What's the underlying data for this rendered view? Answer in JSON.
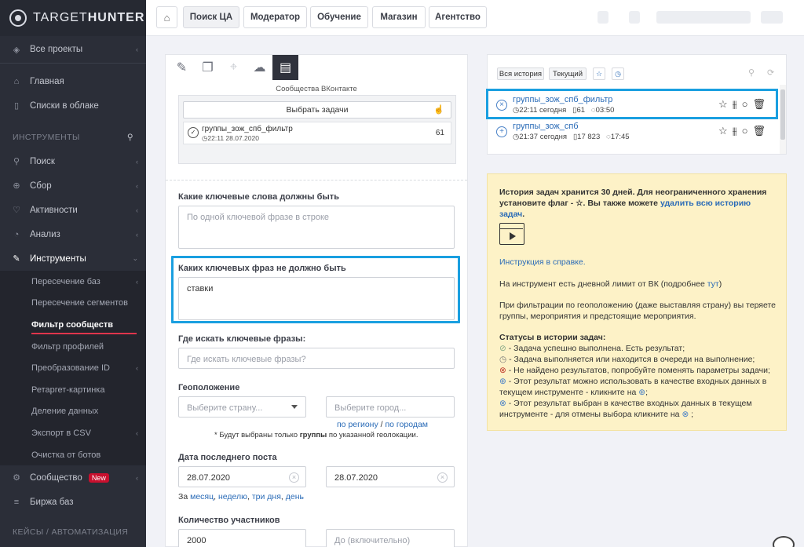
{
  "brand": {
    "name_light": "TARGET",
    "name_bold": "HUNTER"
  },
  "sidebar": {
    "all_projects": "Все проекты",
    "main": "Главная",
    "cloud_lists": "Списки в облаке",
    "section_tools": "ИНСТРУМЕНТЫ",
    "search": "Поиск",
    "collect": "Сбор",
    "activity": "Активности",
    "analysis": "Анализ",
    "tools": "Инструменты",
    "sub": [
      "Пересечение баз",
      "Пересечение сегментов",
      "Фильтр сообществ",
      "Фильтр профилей",
      "Преобразование ID",
      "Ретаргет-картинка",
      "Деление данных",
      "Экспорт в CSV",
      "Очистка от ботов"
    ],
    "community": "Сообщество",
    "new_badge": "New",
    "exchange": "Биржа баз",
    "section_cases": "КЕЙСЫ / АВТОМАТИЗАЦИЯ"
  },
  "topnav": [
    "Поиск ЦА",
    "Модератор",
    "Обучение",
    "Магазин",
    "Агентство"
  ],
  "filter": {
    "vk_title": "Сообщества ВКонтакте",
    "pick_tasks": "Выбрать задачи",
    "task_name": "группы_зож_спб_фильтр",
    "task_meta": "22:11 28.07.2020",
    "task_count": "61",
    "kw_must_label": "Какие ключевые слова должны быть",
    "kw_must_placeholder": "По одной ключевой фразе в строке",
    "kw_not_label": "Каких ключевых фраз не должно быть",
    "kw_not_value": "ставки",
    "where_label": "Где искать ключевые фразы:",
    "where_placeholder": "Где искать ключевые фразы?",
    "geo_label": "Геоположение",
    "country_placeholder": "Выберите страну...",
    "city_placeholder": "Выберите город...",
    "by_region": "по региону",
    "slash": "/",
    "by_cities": "по городам",
    "geo_note_pre": "* Будут выбраны только",
    "geo_note_bold": "группы",
    "geo_note_post": "по указанной геолокации.",
    "last_post_label": "Дата последнего поста",
    "date_from": "28.07.2020",
    "date_to": "28.07.2020",
    "period_prefix": "За",
    "period_month": "месяц",
    "period_week": "неделю",
    "period_3days": "три дня",
    "period_day": "день",
    "members_label": "Количество участников",
    "members_from": "2000",
    "members_to_placeholder": "До (включительно)"
  },
  "history": {
    "tab_all": "Вся история",
    "tab_current": "Текущий",
    "rows": [
      {
        "name": "группы_зож_спб_фильтр",
        "time": "22:11 сегодня",
        "count": "61",
        "duration": "03:50",
        "status": "×"
      },
      {
        "name": "группы_зож_спб",
        "time": "21:37 сегодня",
        "count": "17 823",
        "duration": "17:45",
        "status": "+"
      }
    ]
  },
  "info": {
    "p1_a": "История задач хранится 30 дней. Для неограниченного хранения установите флаг - ☆. Вы также можете",
    "p1_link": "удалить всю историю задач",
    "p1_end": ".",
    "help_link": "Инструкция в справке.",
    "limit_pre": "На инструмент есть дневной лимит от ВК (подробнее",
    "limit_link": "тут",
    "limit_post": ")",
    "geo_warn": "При фильтрации по геоположению (даже выставляя страну) вы теряете группы, мероприятия и предстоящие мероприятия.",
    "statuses_title": "Статусы в истории задач:",
    "s1": "- Задача успешно выполнена. Есть результат;",
    "s2": "- Задача выполняется или находится в очереди на выполнение;",
    "s3": "- Не найдено результатов, попробуйте поменять параметры задачи;",
    "s4": "- Этот результат можно использовать в качестве входных данных в текущем инструменте - кликните на",
    "s5": "- Этот результат выбран в качестве входных данных в текущем инструменте - для отмены выбора кликните на",
    "semicolon": ";"
  }
}
